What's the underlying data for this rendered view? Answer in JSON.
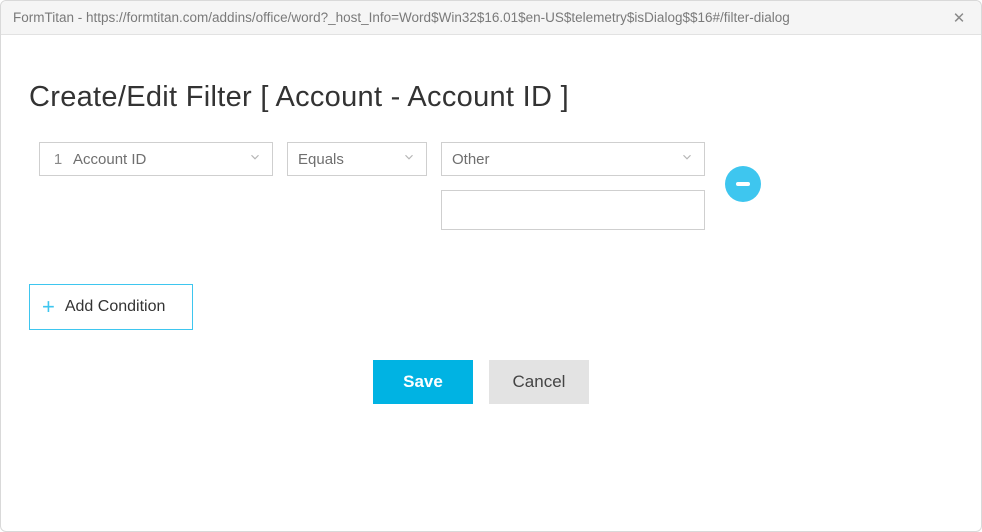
{
  "window": {
    "title": "FormTitan - https://formtitan.com/addins/office/word?_host_Info=Word$Win32$16.01$en-US$telemetry$isDialog$$16#/filter-dialog"
  },
  "page": {
    "heading": "Create/Edit Filter [ Account - Account ID ]"
  },
  "condition": {
    "index": "1",
    "field": "Account ID",
    "operator": "Equals",
    "value_type": "Other",
    "value_text": ""
  },
  "actions": {
    "add_condition": "Add Condition",
    "save": "Save",
    "cancel": "Cancel"
  },
  "colors": {
    "accent": "#00b3e3",
    "accent_light": "#3ec6ef"
  }
}
